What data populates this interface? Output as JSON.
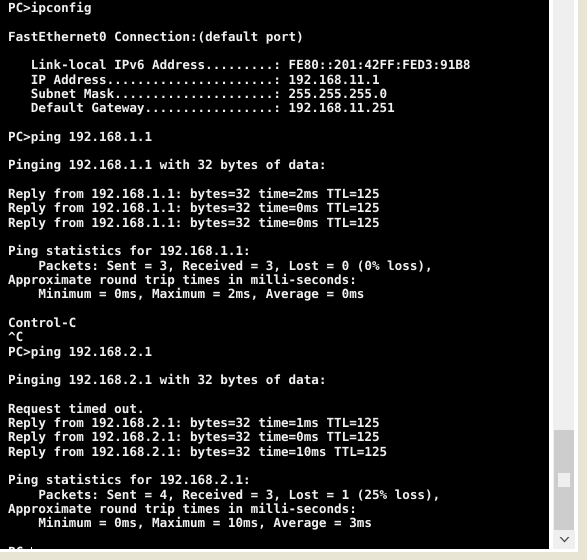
{
  "terminal": {
    "prompt": "PC>",
    "background_color": "#000000",
    "text_color": "#f0f0f0",
    "lines": [
      "PC>ipconfig",
      "",
      "FastEthernet0 Connection:(default port)",
      "",
      "   Link-local IPv6 Address.........: FE80::201:42FF:FED3:91B8",
      "   IP Address......................: 192.168.11.1",
      "   Subnet Mask.....................: 255.255.255.0",
      "   Default Gateway.................: 192.168.11.251",
      "",
      "PC>ping 192.168.1.1",
      "",
      "Pinging 192.168.1.1 with 32 bytes of data:",
      "",
      "Reply from 192.168.1.1: bytes=32 time=2ms TTL=125",
      "Reply from 192.168.1.1: bytes=32 time=0ms TTL=125",
      "Reply from 192.168.1.1: bytes=32 time=0ms TTL=125",
      "",
      "Ping statistics for 192.168.1.1:",
      "    Packets: Sent = 3, Received = 3, Lost = 0 (0% loss),",
      "Approximate round trip times in milli-seconds:",
      "    Minimum = 0ms, Maximum = 2ms, Average = 0ms",
      "",
      "Control-C",
      "^C",
      "PC>ping 192.168.2.1",
      "",
      "Pinging 192.168.2.1 with 32 bytes of data:",
      "",
      "Request timed out.",
      "Reply from 192.168.2.1: bytes=32 time=1ms TTL=125",
      "Reply from 192.168.2.1: bytes=32 time=0ms TTL=125",
      "Reply from 192.168.2.1: bytes=32 time=10ms TTL=125",
      "",
      "Ping statistics for 192.168.2.1:",
      "    Packets: Sent = 4, Received = 3, Lost = 1 (25% loss),",
      "Approximate round trip times in milli-seconds:",
      "    Minimum = 0ms, Maximum = 10ms, Average = 3ms",
      "",
      "PC>"
    ],
    "commands": [
      "ipconfig",
      "ping 192.168.1.1",
      "ping 192.168.2.1"
    ],
    "ipconfig": {
      "adapter": "FastEthernet0 Connection:(default port)",
      "fields": [
        {
          "label": "Link-local IPv6 Address",
          "value": "FE80::201:42FF:FED3:91B8"
        },
        {
          "label": "IP Address",
          "value": "192.168.11.1"
        },
        {
          "label": "Subnet Mask",
          "value": "255.255.255.0"
        },
        {
          "label": "Default Gateway",
          "value": "192.168.11.251"
        }
      ]
    },
    "ping_sessions": [
      {
        "target": "192.168.1.1",
        "payload_bytes": 32,
        "replies": [
          {
            "bytes": 32,
            "time_ms": 2,
            "ttl": 125
          },
          {
            "bytes": 32,
            "time_ms": 0,
            "ttl": 125
          },
          {
            "bytes": 32,
            "time_ms": 0,
            "ttl": 125
          }
        ],
        "timeouts": 0,
        "statistics": {
          "sent": 3,
          "received": 3,
          "lost": 0,
          "loss_percent": 0
        },
        "round_trip": {
          "minimum_ms": 0,
          "maximum_ms": 2,
          "average_ms": 0
        },
        "interrupted": "Control-C"
      },
      {
        "target": "192.168.2.1",
        "payload_bytes": 32,
        "replies": [
          {
            "bytes": 32,
            "time_ms": 1,
            "ttl": 125
          },
          {
            "bytes": 32,
            "time_ms": 0,
            "ttl": 125
          },
          {
            "bytes": 32,
            "time_ms": 10,
            "ttl": 125
          }
        ],
        "timeouts": 1,
        "statistics": {
          "sent": 4,
          "received": 3,
          "lost": 1,
          "loss_percent": 25
        },
        "round_trip": {
          "minimum_ms": 0,
          "maximum_ms": 10,
          "average_ms": 3
        }
      }
    ]
  },
  "scrollbar": {
    "orientation": "vertical",
    "down_arrow_icon": "chevron-down-icon",
    "thumb_position": "near-bottom",
    "track_color": "#efefef",
    "thumb_color": "#cdcdcd"
  },
  "window": {
    "frame_color": "#ffffff",
    "page_background_color": "#e8e5d5"
  }
}
